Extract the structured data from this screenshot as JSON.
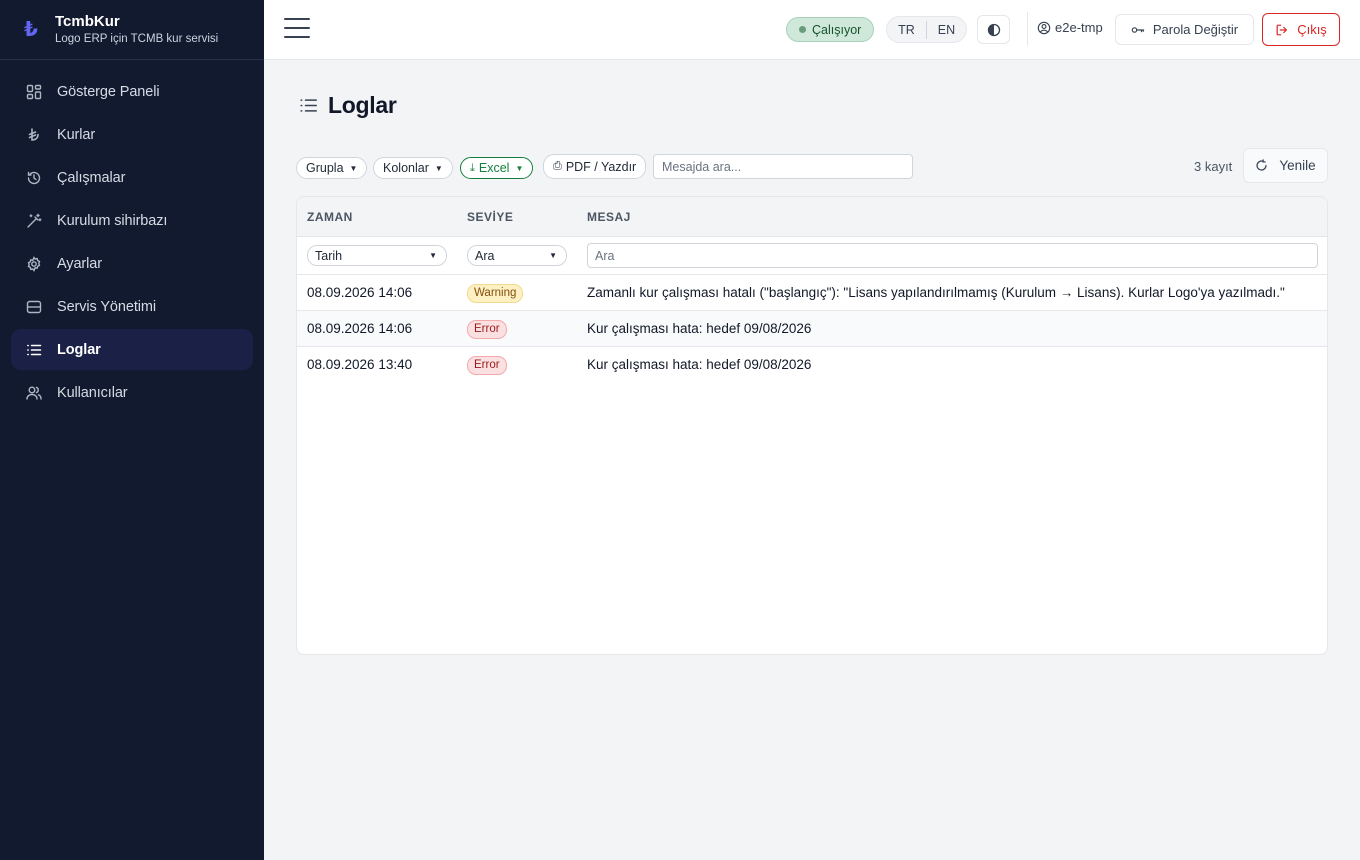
{
  "brand": {
    "logo": "₺",
    "title": "TcmbKur",
    "subtitle": "Logo ERP için TCMB kur servisi"
  },
  "sidebar": {
    "items": [
      {
        "label": "Gösterge Paneli",
        "icon": "dashboard-icon"
      },
      {
        "label": "Kurlar",
        "icon": "lira-icon"
      },
      {
        "label": "Çalışmalar",
        "icon": "history-icon"
      },
      {
        "label": "Kurulum sihirbazı",
        "icon": "wand-icon"
      },
      {
        "label": "Ayarlar",
        "icon": "gear-icon"
      },
      {
        "label": "Servis Yönetimi",
        "icon": "server-icon"
      },
      {
        "label": "Loglar",
        "icon": "list-icon",
        "active": true
      },
      {
        "label": "Kullanıcılar",
        "icon": "users-icon"
      }
    ]
  },
  "topbar": {
    "status": "Çalışıyor",
    "lang_tr": "TR",
    "lang_en": "EN",
    "user": "e2e-tmp",
    "password_label": "Parola Değiştir",
    "logout_label": "Çıkış"
  },
  "page": {
    "title": "Loglar"
  },
  "toolbar": {
    "group_label": "Grupla",
    "columns_label": "Kolonlar",
    "excel_label": "Excel",
    "pdf_label": "PDF / Yazdır",
    "search_placeholder": "Mesajda ara...",
    "count": "3 kayıt",
    "refresh_label": "Yenile"
  },
  "table": {
    "headers": {
      "time": "ZAMAN",
      "level": "SEVİYE",
      "message": "MESAJ"
    },
    "filters": {
      "time": "Tarih",
      "level": "Ara",
      "message_placeholder": "Ara"
    },
    "rows": [
      {
        "time": "08.09.2026 14:06",
        "level": "Warning",
        "message": "Zamanlı kur çalışması hatalı (\"başlangıç\"): \"Lisans yapılandırılmamış (Kurulum → Lisans). Kurlar Logo'ya yazılmadı.\""
      },
      {
        "time": "08.09.2026 14:06",
        "level": "Error",
        "message": "Kur çalışması hata: hedef 09/08/2026"
      },
      {
        "time": "08.09.2026 13:40",
        "level": "Error",
        "message": "Kur çalışması hata: hedef 09/08/2026"
      }
    ]
  }
}
